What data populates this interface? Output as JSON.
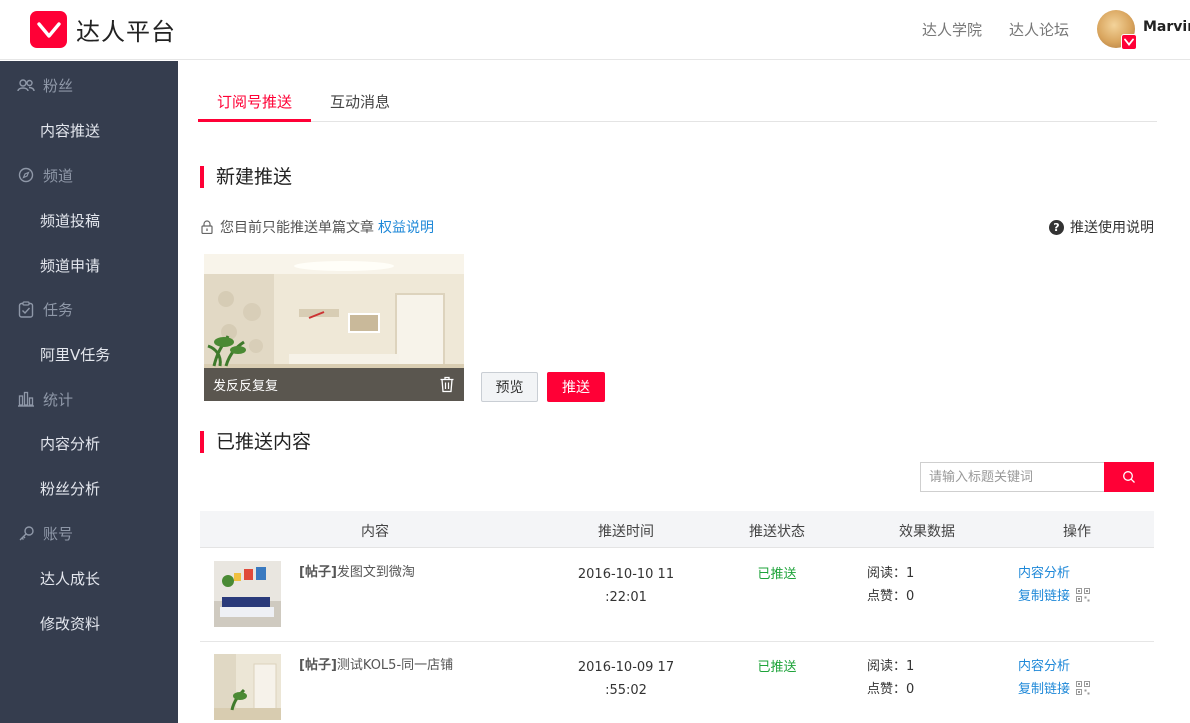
{
  "header": {
    "brand": "达人平台",
    "links": [
      "达人学院",
      "达人论坛"
    ],
    "username": "Marvin|"
  },
  "sidebar": {
    "sections": [
      {
        "group": "粉丝",
        "icon": "fans-icon",
        "items": [
          "内容推送"
        ]
      },
      {
        "group": "频道",
        "icon": "compass-icon",
        "items": [
          "频道投稿",
          "频道申请"
        ]
      },
      {
        "group": "任务",
        "icon": "clipboard-icon",
        "items": [
          "阿里V任务"
        ]
      },
      {
        "group": "统计",
        "icon": "bar-chart-icon",
        "items": [
          "内容分析",
          "粉丝分析"
        ]
      },
      {
        "group": "账号",
        "icon": "key-icon",
        "items": [
          "达人成长",
          "修改资料"
        ]
      }
    ]
  },
  "tabs": [
    {
      "label": "订阅号推送",
      "active": true
    },
    {
      "label": "互动消息",
      "active": false
    }
  ],
  "new_push": {
    "title": "新建推送",
    "notice": "您目前只能推送单篇文章",
    "notice_link": "权益说明",
    "help": "推送使用说明",
    "card_title": "发反反复复",
    "preview_label": "预览",
    "push_label": "推送"
  },
  "pushed": {
    "title": "已推送内容",
    "search_placeholder": "请输入标题关键词",
    "columns": [
      "内容",
      "推送时间",
      "推送状态",
      "效果数据",
      "操作"
    ],
    "rows": [
      {
        "tag": "[帖子]",
        "title": "发图文到微淘",
        "time_line1": "2016-10-10 11",
        "time_line2": ":22:01",
        "status": "已推送",
        "reads": "阅读：1",
        "likes": "点赞：0",
        "op_analysis": "内容分析",
        "op_copy": "复制链接"
      },
      {
        "tag": "[帖子]",
        "title": "测试KOL5-同一店铺",
        "time_line1": "2016-10-09 17",
        "time_line2": ":55:02",
        "status": "已推送",
        "reads": "阅读：1",
        "likes": "点赞：0",
        "op_analysis": "内容分析",
        "op_copy": "复制链接"
      }
    ]
  },
  "colors": {
    "accent": "#ff0036",
    "sidebar": "#353d4e",
    "link": "#1e88d8",
    "success": "#1ea33a"
  }
}
